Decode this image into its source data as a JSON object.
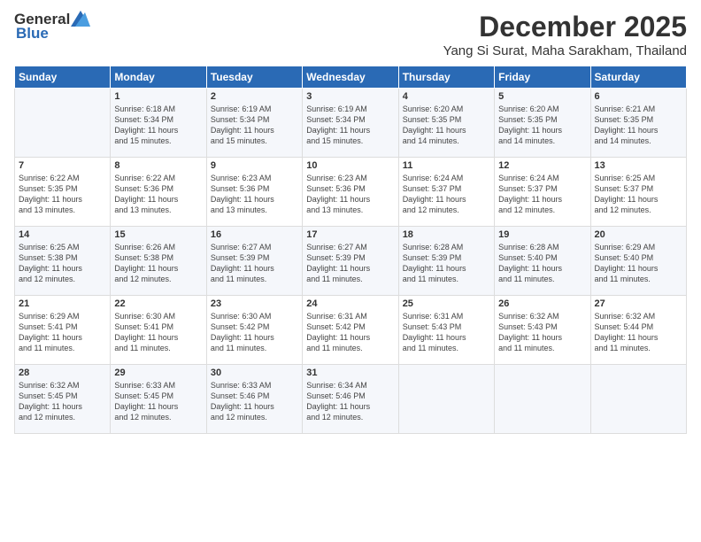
{
  "header": {
    "logo_text_general": "General",
    "logo_text_blue": "Blue",
    "month": "December 2025",
    "location": "Yang Si Surat, Maha Sarakham, Thailand"
  },
  "weekdays": [
    "Sunday",
    "Monday",
    "Tuesday",
    "Wednesday",
    "Thursday",
    "Friday",
    "Saturday"
  ],
  "weeks": [
    [
      {
        "day": "",
        "info": ""
      },
      {
        "day": "1",
        "info": "Sunrise: 6:18 AM\nSunset: 5:34 PM\nDaylight: 11 hours\nand 15 minutes."
      },
      {
        "day": "2",
        "info": "Sunrise: 6:19 AM\nSunset: 5:34 PM\nDaylight: 11 hours\nand 15 minutes."
      },
      {
        "day": "3",
        "info": "Sunrise: 6:19 AM\nSunset: 5:34 PM\nDaylight: 11 hours\nand 15 minutes."
      },
      {
        "day": "4",
        "info": "Sunrise: 6:20 AM\nSunset: 5:35 PM\nDaylight: 11 hours\nand 14 minutes."
      },
      {
        "day": "5",
        "info": "Sunrise: 6:20 AM\nSunset: 5:35 PM\nDaylight: 11 hours\nand 14 minutes."
      },
      {
        "day": "6",
        "info": "Sunrise: 6:21 AM\nSunset: 5:35 PM\nDaylight: 11 hours\nand 14 minutes."
      }
    ],
    [
      {
        "day": "7",
        "info": "Sunrise: 6:22 AM\nSunset: 5:35 PM\nDaylight: 11 hours\nand 13 minutes."
      },
      {
        "day": "8",
        "info": "Sunrise: 6:22 AM\nSunset: 5:36 PM\nDaylight: 11 hours\nand 13 minutes."
      },
      {
        "day": "9",
        "info": "Sunrise: 6:23 AM\nSunset: 5:36 PM\nDaylight: 11 hours\nand 13 minutes."
      },
      {
        "day": "10",
        "info": "Sunrise: 6:23 AM\nSunset: 5:36 PM\nDaylight: 11 hours\nand 13 minutes."
      },
      {
        "day": "11",
        "info": "Sunrise: 6:24 AM\nSunset: 5:37 PM\nDaylight: 11 hours\nand 12 minutes."
      },
      {
        "day": "12",
        "info": "Sunrise: 6:24 AM\nSunset: 5:37 PM\nDaylight: 11 hours\nand 12 minutes."
      },
      {
        "day": "13",
        "info": "Sunrise: 6:25 AM\nSunset: 5:37 PM\nDaylight: 11 hours\nand 12 minutes."
      }
    ],
    [
      {
        "day": "14",
        "info": "Sunrise: 6:25 AM\nSunset: 5:38 PM\nDaylight: 11 hours\nand 12 minutes."
      },
      {
        "day": "15",
        "info": "Sunrise: 6:26 AM\nSunset: 5:38 PM\nDaylight: 11 hours\nand 12 minutes."
      },
      {
        "day": "16",
        "info": "Sunrise: 6:27 AM\nSunset: 5:39 PM\nDaylight: 11 hours\nand 11 minutes."
      },
      {
        "day": "17",
        "info": "Sunrise: 6:27 AM\nSunset: 5:39 PM\nDaylight: 11 hours\nand 11 minutes."
      },
      {
        "day": "18",
        "info": "Sunrise: 6:28 AM\nSunset: 5:39 PM\nDaylight: 11 hours\nand 11 minutes."
      },
      {
        "day": "19",
        "info": "Sunrise: 6:28 AM\nSunset: 5:40 PM\nDaylight: 11 hours\nand 11 minutes."
      },
      {
        "day": "20",
        "info": "Sunrise: 6:29 AM\nSunset: 5:40 PM\nDaylight: 11 hours\nand 11 minutes."
      }
    ],
    [
      {
        "day": "21",
        "info": "Sunrise: 6:29 AM\nSunset: 5:41 PM\nDaylight: 11 hours\nand 11 minutes."
      },
      {
        "day": "22",
        "info": "Sunrise: 6:30 AM\nSunset: 5:41 PM\nDaylight: 11 hours\nand 11 minutes."
      },
      {
        "day": "23",
        "info": "Sunrise: 6:30 AM\nSunset: 5:42 PM\nDaylight: 11 hours\nand 11 minutes."
      },
      {
        "day": "24",
        "info": "Sunrise: 6:31 AM\nSunset: 5:42 PM\nDaylight: 11 hours\nand 11 minutes."
      },
      {
        "day": "25",
        "info": "Sunrise: 6:31 AM\nSunset: 5:43 PM\nDaylight: 11 hours\nand 11 minutes."
      },
      {
        "day": "26",
        "info": "Sunrise: 6:32 AM\nSunset: 5:43 PM\nDaylight: 11 hours\nand 11 minutes."
      },
      {
        "day": "27",
        "info": "Sunrise: 6:32 AM\nSunset: 5:44 PM\nDaylight: 11 hours\nand 11 minutes."
      }
    ],
    [
      {
        "day": "28",
        "info": "Sunrise: 6:32 AM\nSunset: 5:45 PM\nDaylight: 11 hours\nand 12 minutes."
      },
      {
        "day": "29",
        "info": "Sunrise: 6:33 AM\nSunset: 5:45 PM\nDaylight: 11 hours\nand 12 minutes."
      },
      {
        "day": "30",
        "info": "Sunrise: 6:33 AM\nSunset: 5:46 PM\nDaylight: 11 hours\nand 12 minutes."
      },
      {
        "day": "31",
        "info": "Sunrise: 6:34 AM\nSunset: 5:46 PM\nDaylight: 11 hours\nand 12 minutes."
      },
      {
        "day": "",
        "info": ""
      },
      {
        "day": "",
        "info": ""
      },
      {
        "day": "",
        "info": ""
      }
    ]
  ]
}
